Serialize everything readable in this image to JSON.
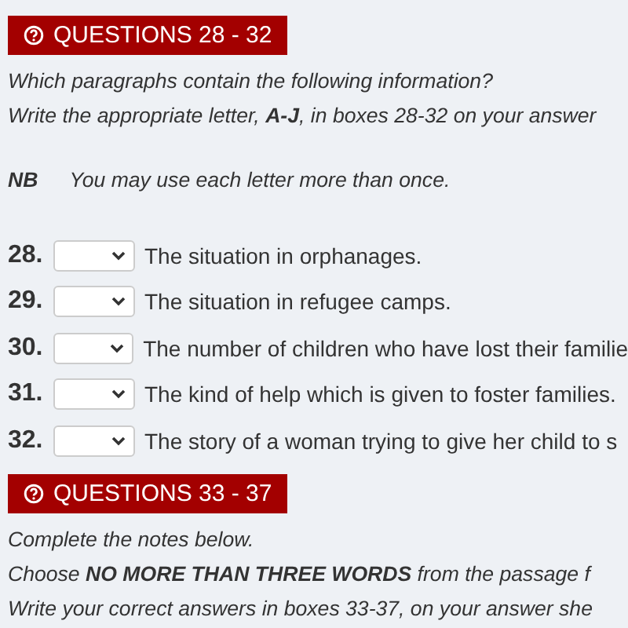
{
  "sections": [
    {
      "header": "QUESTIONS 28 - 32",
      "instructions": [
        "Which paragraphs contain the following information?",
        "Write the appropriate letter, **A-J**, in boxes 28-32 on your answer"
      ],
      "note": {
        "label": "NB",
        "text": "You may use each letter more than once."
      },
      "questions": [
        {
          "number": "28.",
          "text": "The situation in orphanages."
        },
        {
          "number": "29.",
          "text": "The situation in refugee camps."
        },
        {
          "number": "30.",
          "text": "The number of children who have lost their familie"
        },
        {
          "number": "31.",
          "text": "The kind of help which is given to foster families."
        },
        {
          "number": "32.",
          "text": "The story of a woman trying to give her child to s"
        }
      ]
    },
    {
      "header": "QUESTIONS 33 - 37",
      "instructions": [
        "Complete the notes below.",
        "Choose **NO MORE THAN THREE WORDS** from the passage f",
        "Write your correct answers in boxes 33-37, on your answer she"
      ]
    }
  ]
}
